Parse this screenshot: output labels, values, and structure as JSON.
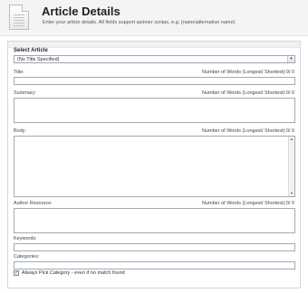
{
  "header": {
    "title": "Article Details",
    "subtitle": "Enter your article details. All fields support spinner syntax, e.g. {name|alternative name}."
  },
  "select_article": {
    "label": "Select Article",
    "value": "(No Title Specified)"
  },
  "fields": {
    "title": {
      "label": "Title:",
      "counter": "Number of Words (Longest/ Shortest):0/ 0"
    },
    "summary": {
      "label": "Summary:",
      "counter": "Number of Words (Longest/ Shortest):0/ 0"
    },
    "body": {
      "label": "Body:",
      "counter": "Number of Words (Longest/ Shortest):0/ 0"
    },
    "author_resource": {
      "label": "Author Resource:",
      "counter": "Number of Words (Longest/ Shortest):0/ 0"
    },
    "keywords": {
      "label": "Keywords:"
    },
    "categories": {
      "label": "Categories:"
    }
  },
  "always_pick_category": {
    "checked": true,
    "label": "Always Pick Category - even if no match found"
  },
  "icons": {
    "document": "document-icon",
    "dropdown": "chevron-down-icon",
    "scroll_up": "arrow-up-icon",
    "scroll_down": "arrow-down-icon",
    "check": "checkmark-icon"
  }
}
